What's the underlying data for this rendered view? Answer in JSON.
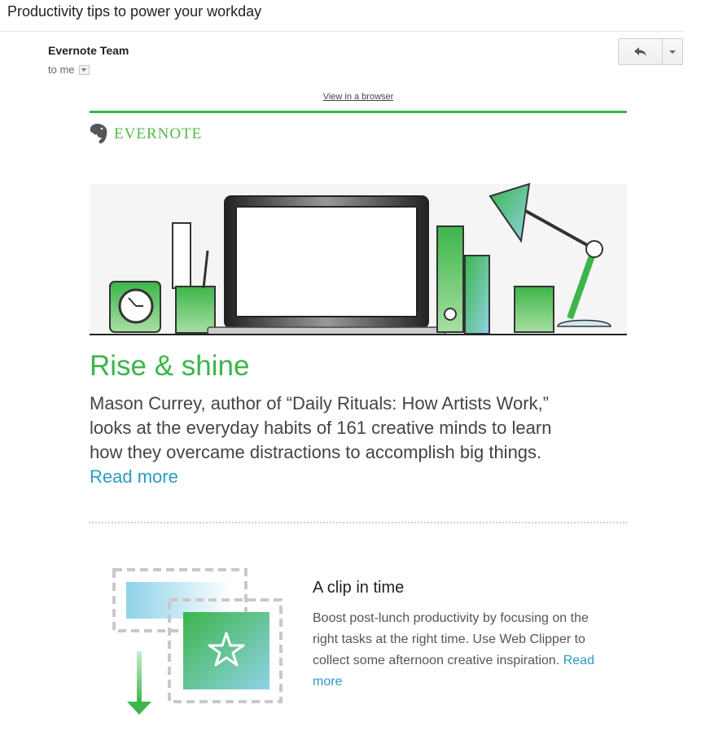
{
  "email": {
    "subject": "Productivity tips to power your workday",
    "sender": "Evernote Team",
    "recipient": "to me"
  },
  "toolbar": {
    "reply_icon": "reply-icon",
    "more_icon": "chevron-down-icon"
  },
  "newsletter": {
    "view_in_browser": "View in a browser",
    "brand": "EVERNOTE",
    "brand_color": "#3cb54a",
    "link_color": "#2b9bc2",
    "hero": {
      "heading": "Rise & shine",
      "body": "Mason Currey, author of “Daily Rituals: How Artists Work,” looks at the everyday habits of 161 creative minds to learn how they overcame distractions to accomplish big things.",
      "link": "Read more"
    },
    "feature": {
      "heading": "A clip in time",
      "body": "Boost post-lunch productivity by focusing on the right tasks at the right time. Use Web Clipper to collect some afternoon creative inspiration.",
      "link": "Read more"
    }
  }
}
